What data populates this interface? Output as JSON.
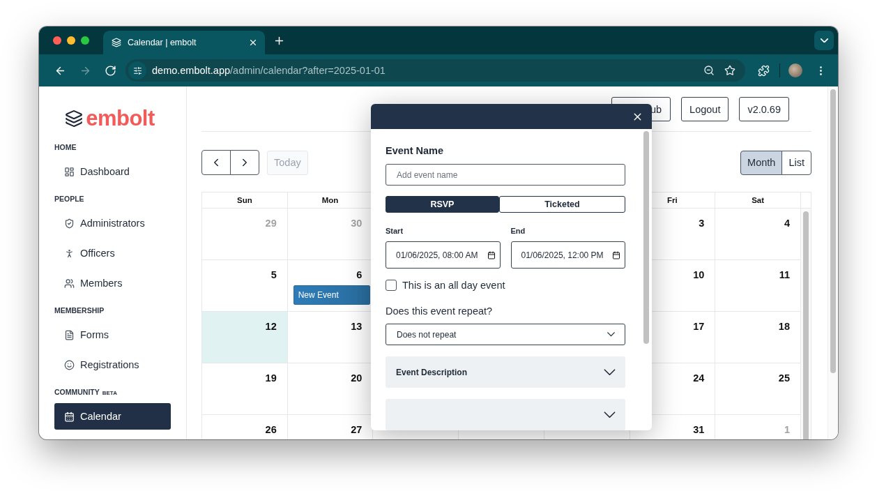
{
  "browser": {
    "tab": {
      "title": "Calendar | embolt"
    },
    "nav_buttons": [
      {
        "kind": "back",
        "disabled": false
      },
      {
        "kind": "forward",
        "disabled": true
      },
      {
        "kind": "reload",
        "disabled": false
      }
    ],
    "address": {
      "host": "demo.embolt.app",
      "path": "/admin/calendar?after=2025-01-01"
    }
  },
  "sidebar": {
    "logo": "embolt",
    "sections": [
      {
        "title": "HOME",
        "items": [
          {
            "label": "Dashboard",
            "kind": "dashboard",
            "selected": false
          }
        ]
      },
      {
        "title": "PEOPLE",
        "items": [
          {
            "label": "Administrators",
            "kind": "shield",
            "selected": false
          },
          {
            "label": "Officers",
            "kind": "officers",
            "selected": false
          },
          {
            "label": "Members",
            "kind": "members",
            "selected": false
          }
        ]
      },
      {
        "title": "MEMBERSHIP",
        "items": [
          {
            "label": "Forms",
            "kind": "forms",
            "selected": false
          },
          {
            "label": "Registrations",
            "kind": "registrations",
            "selected": false
          }
        ]
      },
      {
        "title": "COMMUNITY",
        "badge": "BETA",
        "items": [
          {
            "label": "Calendar",
            "kind": "calendar",
            "selected": true
          }
        ]
      }
    ]
  },
  "header_buttons": [
    "ub",
    "Logout",
    "v2.0.69"
  ],
  "toolbar": {
    "today": {
      "label": "Today",
      "disabled": true
    },
    "views": [
      {
        "label": "Month",
        "selected": true
      },
      {
        "label": "List",
        "selected": false
      }
    ]
  },
  "calendar": {
    "weekdays": {
      "sun": "Sun",
      "mon": "Mon",
      "fri": "Fri",
      "sat": "Sat"
    },
    "weeks": [
      {
        "sun": {
          "day": "29",
          "muted": true,
          "today": false
        },
        "mon": {
          "day": "30",
          "muted": true,
          "today": false
        },
        "fri": {
          "day": "3",
          "muted": false,
          "today": false
        },
        "sat": {
          "day": "4",
          "muted": false,
          "today": false
        }
      },
      {
        "sun": {
          "day": "5",
          "muted": false,
          "today": false
        },
        "mon": {
          "day": "6",
          "muted": false,
          "today": false,
          "events": [
            "New Event"
          ]
        },
        "fri": {
          "day": "10",
          "muted": false,
          "today": false
        },
        "sat": {
          "day": "11",
          "muted": false,
          "today": false
        }
      },
      {
        "sun": {
          "day": "12",
          "muted": false,
          "today": true
        },
        "mon": {
          "day": "13",
          "muted": false,
          "today": false
        },
        "fri": {
          "day": "17",
          "muted": false,
          "today": false
        },
        "sat": {
          "day": "18",
          "muted": false,
          "today": false
        }
      },
      {
        "sun": {
          "day": "19",
          "muted": false,
          "today": false
        },
        "mon": {
          "day": "20",
          "muted": false,
          "today": false
        },
        "fri": {
          "day": "24",
          "muted": false,
          "today": false
        },
        "sat": {
          "day": "25",
          "muted": false,
          "today": false
        }
      },
      {
        "sun": {
          "day": "26",
          "muted": false,
          "today": false
        },
        "mon": {
          "day": "27",
          "muted": false,
          "today": false
        },
        "fri": {
          "day": "31",
          "muted": false,
          "today": false
        },
        "sat": {
          "day": "1",
          "muted": true,
          "today": false
        }
      }
    ]
  },
  "modal": {
    "name_label": "Event Name",
    "name_field": {
      "placeholder": "Add event name"
    },
    "ticket_types": [
      {
        "label": "RSVP",
        "selected": true
      },
      {
        "label": "Ticketed",
        "selected": false
      }
    ],
    "start": {
      "label": "Start",
      "value": "01/06/2025, 08:00 AM"
    },
    "end": {
      "label": "End",
      "value": "01/06/2025, 12:00 PM"
    },
    "all_day": {
      "label": "This is an all day event",
      "checked": false
    },
    "repeat": {
      "label": "Does this event repeat?",
      "value": "Does not repeat"
    },
    "sections": [
      {
        "title": "Event Description",
        "expanded": false
      },
      {
        "expanded": false
      }
    ]
  }
}
